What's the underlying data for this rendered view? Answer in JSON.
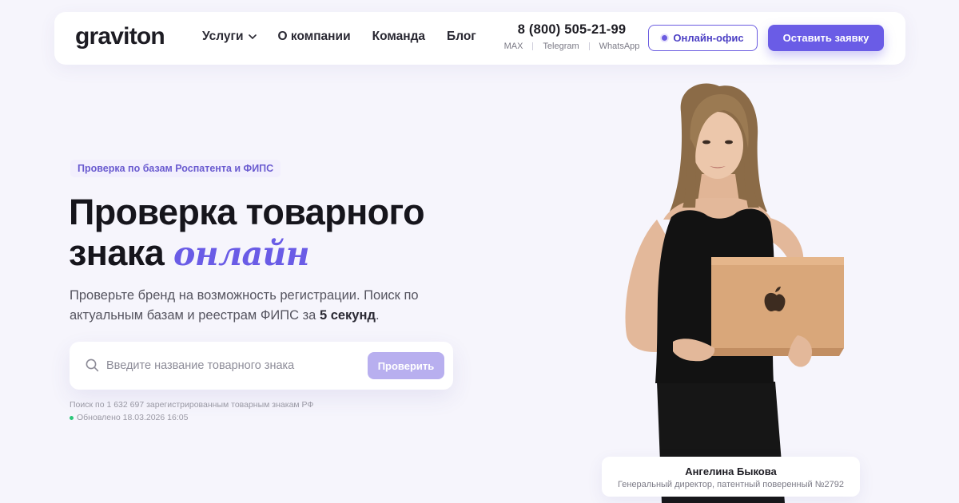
{
  "header": {
    "logo": "graviton",
    "nav": [
      {
        "label": "Услуги",
        "has_dropdown": true
      },
      {
        "label": "О компании"
      },
      {
        "label": "Команда"
      },
      {
        "label": "Блог"
      }
    ],
    "phone": "8 (800) 505-21-99",
    "messengers": [
      "MAX",
      "Telegram",
      "WhatsApp"
    ],
    "office_button": "Онлайн-офис",
    "request_button": "Оставить заявку"
  },
  "hero": {
    "badge": "Проверка по базам Роспатента и ФИПС",
    "title_line1": "Проверка товарного",
    "title_line2": "знака",
    "title_accent": "онлайн",
    "lead_text": "Проверьте бренд на возможность регистрации. Поиск по актуальным базам и реестрам ФИПС за",
    "lead_bold": "5 секунд",
    "lead_end": "."
  },
  "search": {
    "placeholder": "Введите название товарного знака",
    "value": "",
    "button": "Проверить",
    "stats": "Поиск по 1 632 697 зарегистрированным товарным знакам РФ",
    "updated": "Обновлено 18.03.2026 16:05"
  },
  "person": {
    "name": "Ангелина Быкова",
    "role": "Генеральный директор, патентный поверенный №2792"
  },
  "colors": {
    "accent": "#6a5ce6",
    "background": "#f6f5fc",
    "status_online": "#2dc77a"
  },
  "icons": [
    "chevron-down-icon",
    "online-dot-icon",
    "search-icon",
    "status-dot-icon",
    "apple-logo-icon"
  ]
}
